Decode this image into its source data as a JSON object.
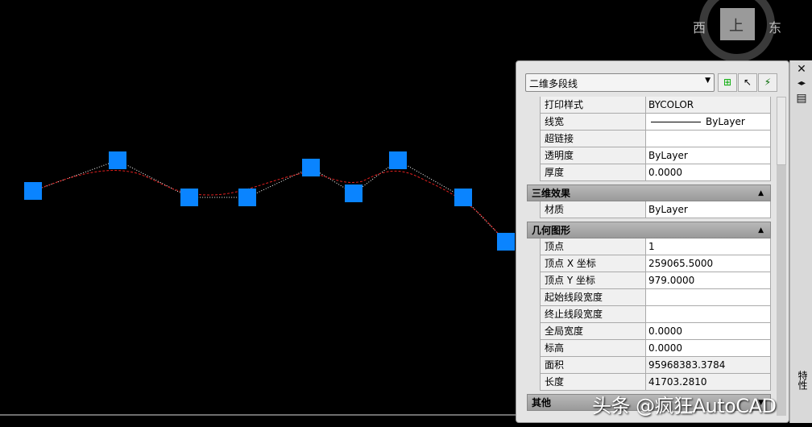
{
  "viewcube": {
    "west": "西",
    "east": "东",
    "top": "上"
  },
  "palette": {
    "object_type": "二维多段线",
    "toolbar": [
      {
        "icon": "toggle-pickadd-icon"
      },
      {
        "icon": "select-objects-icon"
      },
      {
        "icon": "quick-select-icon"
      }
    ],
    "general_rows": [
      {
        "label": "打印样式",
        "value": "BYCOLOR"
      },
      {
        "label": "线宽",
        "value": "ByLayer"
      },
      {
        "label": "超链接",
        "value": ""
      },
      {
        "label": "透明度",
        "value": "ByLayer"
      },
      {
        "label": "厚度",
        "value": "0.0000"
      }
    ],
    "sections": {
      "3d": "三维效果",
      "geometry": "几何图形",
      "misc": "其他"
    },
    "3d_rows": [
      {
        "label": "材质",
        "value": "ByLayer"
      }
    ],
    "geometry_rows": [
      {
        "label": "顶点",
        "value": "1"
      },
      {
        "label": "顶点 X 坐标",
        "value": "259065.5000"
      },
      {
        "label": "顶点 Y 坐标",
        "value": "979.0000"
      },
      {
        "label": "起始线段宽度",
        "value": ""
      },
      {
        "label": "终止线段宽度",
        "value": ""
      },
      {
        "label": "全局宽度",
        "value": "0.0000"
      },
      {
        "label": "标高",
        "value": "0.0000"
      },
      {
        "label": "面积",
        "value": "95968383.3784"
      },
      {
        "label": "长度",
        "value": "41703.2810"
      }
    ],
    "side_title": "特性"
  },
  "watermark": "头条 @疯狂AutoCAD",
  "colors": {
    "grip": "#0a84ff",
    "curve": "#e02020"
  }
}
